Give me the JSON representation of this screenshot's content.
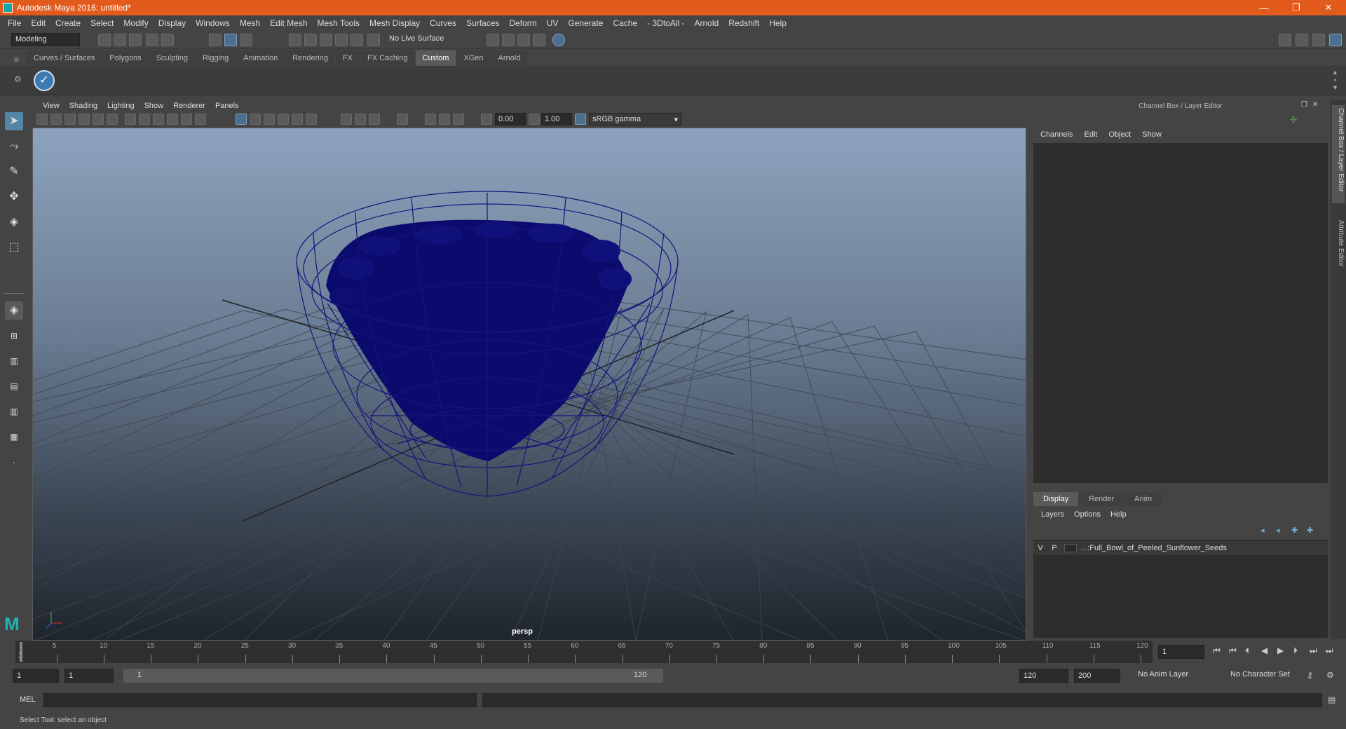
{
  "window": {
    "title": "Autodesk Maya 2016: untitled*",
    "controls": [
      "—",
      "❐",
      "✕"
    ]
  },
  "menubar": [
    "File",
    "Edit",
    "Create",
    "Select",
    "Modify",
    "Display",
    "Windows",
    "Mesh",
    "Edit Mesh",
    "Mesh Tools",
    "Mesh Display",
    "Curves",
    "Surfaces",
    "Deform",
    "UV",
    "Generate",
    "Cache",
    "- 3DtoAll -",
    "Arnold",
    "Redshift",
    "Help"
  ],
  "statusline": {
    "mode": "Modeling",
    "live_surface": "No Live Surface"
  },
  "shelf": {
    "tabs": [
      "Curves / Surfaces",
      "Polygons",
      "Sculpting",
      "Rigging",
      "Animation",
      "Rendering",
      "FX",
      "FX Caching",
      "Custom",
      "XGen",
      "Arnold"
    ],
    "active_tab": "Custom"
  },
  "viewport": {
    "menu": [
      "View",
      "Shading",
      "Lighting",
      "Show",
      "Renderer",
      "Panels"
    ],
    "exposure": "0.00",
    "gamma": "1.00",
    "colorspace": "sRGB gamma",
    "camera_label": "persp"
  },
  "channel_box": {
    "title": "Channel Box / Layer Editor",
    "menu": [
      "Channels",
      "Edit",
      "Object",
      "Show"
    ]
  },
  "layer_editor": {
    "tabs": [
      "Display",
      "Render",
      "Anim"
    ],
    "active_tab": "Display",
    "menu": [
      "Layers",
      "Options",
      "Help"
    ],
    "layer": {
      "v": "V",
      "p": "P",
      "name": "...:Full_Bowl_of_Peeled_Sunflower_Seeds"
    }
  },
  "side_tabs": [
    "Channel Box / Layer Editor",
    "Attribute Editor"
  ],
  "timeline": {
    "ticks": [
      5,
      10,
      15,
      20,
      25,
      30,
      35,
      40,
      45,
      50,
      55,
      60,
      65,
      70,
      75,
      80,
      85,
      90,
      95,
      100,
      105,
      110,
      115,
      120
    ],
    "first_label": "1",
    "current_frame": "1"
  },
  "range": {
    "start": "1",
    "playback_start": "1",
    "slider_start": "1",
    "slider_end": "120",
    "playback_end": "120",
    "end": "200",
    "anim_layer": "No Anim Layer",
    "character_set": "No Character Set"
  },
  "command_line": {
    "label": "MEL"
  },
  "help_line": "Select Tool: select an object",
  "colors": {
    "title_bar": "#e25a1c",
    "active_tab": "#5a5a5a",
    "wireframe": "#0a0a6e"
  }
}
